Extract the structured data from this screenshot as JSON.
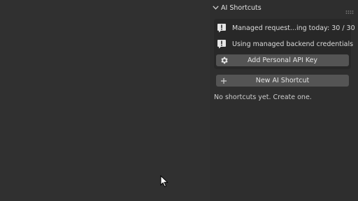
{
  "panel": {
    "title": "AI Shortcuts",
    "status_rows": [
      {
        "icon": "info-icon",
        "text": "Managed request...ing today: 30 / 30"
      },
      {
        "icon": "info-icon",
        "text": "Using managed backend credentials"
      }
    ],
    "add_key_button": {
      "icon": "gear-icon",
      "label": "Add Personal API Key"
    },
    "new_shortcut_button": {
      "icon": "plus-icon",
      "label": "New AI Shortcut"
    },
    "empty_message": "No shortcuts yet. Create one."
  }
}
